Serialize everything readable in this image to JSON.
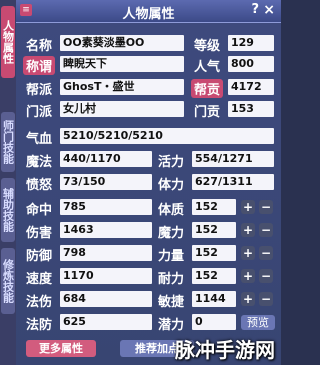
{
  "side_tabs": [
    {
      "label": "人物属性",
      "active": true
    },
    {
      "label": "师门技能",
      "active": false
    },
    {
      "label": "辅助技能",
      "active": false
    },
    {
      "label": "修炼技能",
      "active": false
    }
  ],
  "window": {
    "title": "人物属性",
    "help": "?",
    "close": "×",
    "menu_icon": "≡"
  },
  "labels": {
    "name": "名称",
    "title": "称谓",
    "faction": "帮派",
    "school": "门派",
    "level": "等级",
    "popularity": "人气",
    "contribution": "帮贡",
    "school_contrib": "门贡",
    "hp": "气血",
    "mp": "魔法",
    "vitality": "活力",
    "anger": "愤怒",
    "stamina": "体力",
    "hit": "命中",
    "damage": "伤害",
    "defense": "防御",
    "speed": "速度",
    "spell_damage": "法伤",
    "spell_defense": "法防",
    "con": "体质",
    "mag": "魔力",
    "str": "力量",
    "end": "耐力",
    "agi": "敏捷",
    "potential": "潜力"
  },
  "values": {
    "name": "OO素葵淡墨OO",
    "title": "睥睨天下",
    "faction": "GhosT・盛世",
    "school": "女儿村",
    "level": "129",
    "popularity": "800",
    "contribution": "4172",
    "school_contrib": "153",
    "hp": "5210/5210/5210",
    "mp": "440/1170",
    "vitality": "554/1271",
    "anger": "73/150",
    "stamina": "627/1311",
    "hit": "785",
    "damage": "1463",
    "defense": "798",
    "speed": "1170",
    "spell_damage": "684",
    "spell_defense": "625",
    "con": "152",
    "mag": "152",
    "str": "152",
    "end": "152",
    "agi": "1144",
    "potential": "0"
  },
  "buttons": {
    "plus": "+",
    "minus": "−",
    "preview": "预览",
    "more_attr": "更多属性",
    "recommend": "推荐加点"
  },
  "watermark": "脉冲手游网"
}
